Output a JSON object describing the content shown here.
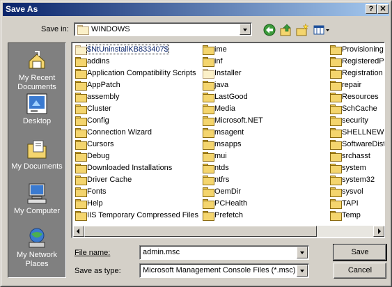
{
  "window": {
    "title": "Save As",
    "help_label": "?",
    "close_label": "✕"
  },
  "toolbar": {
    "save_in_label": "Save in:",
    "location": "WINDOWS",
    "icons": [
      "back-icon",
      "up-folder-icon",
      "new-folder-icon",
      "view-menu-icon"
    ]
  },
  "places": [
    {
      "name": "recent-documents",
      "label": "My Recent Documents"
    },
    {
      "name": "desktop",
      "label": "Desktop"
    },
    {
      "name": "my-documents",
      "label": "My Documents"
    },
    {
      "name": "my-computer",
      "label": "My Computer"
    },
    {
      "name": "my-network-places",
      "label": "My Network Places"
    }
  ],
  "files": {
    "col1": [
      "$NtUninstallKB833407$",
      "addins",
      "Application Compatibility Scripts",
      "AppPatch",
      "assembly",
      "Cluster",
      "Config",
      "Connection Wizard",
      "Cursors",
      "Debug",
      "Downloaded Installations",
      "Driver Cache",
      "Fonts",
      "Help",
      "IIS Temporary Compressed Files"
    ],
    "col2": [
      "ime",
      "inf",
      "Installer",
      "java",
      "LastGood",
      "Media",
      "Microsoft.NET",
      "msagent",
      "msapps",
      "mui",
      "ntds",
      "ntfrs",
      "OemDir",
      "PCHealth",
      "Prefetch"
    ],
    "col3": [
      "Provisioning",
      "RegisteredPa",
      "Registration",
      "repair",
      "Resources",
      "SchCache",
      "security",
      "SHELLNEW",
      "SoftwareDist",
      "srchasst",
      "system",
      "system32",
      "sysvol",
      "TAPI",
      "Temp"
    ]
  },
  "form": {
    "file_name_label": "File name:",
    "file_name_value": "admin.msc",
    "save_as_type_label": "Save as type:",
    "save_as_type_value": "Microsoft Management Console Files (*.msc)"
  },
  "buttons": {
    "save": "Save",
    "cancel": "Cancel"
  },
  "colors": {
    "titlebar_start": "#0a246a",
    "titlebar_end": "#a6caf0",
    "face": "#d4d0c8",
    "places_bg": "#808080"
  }
}
